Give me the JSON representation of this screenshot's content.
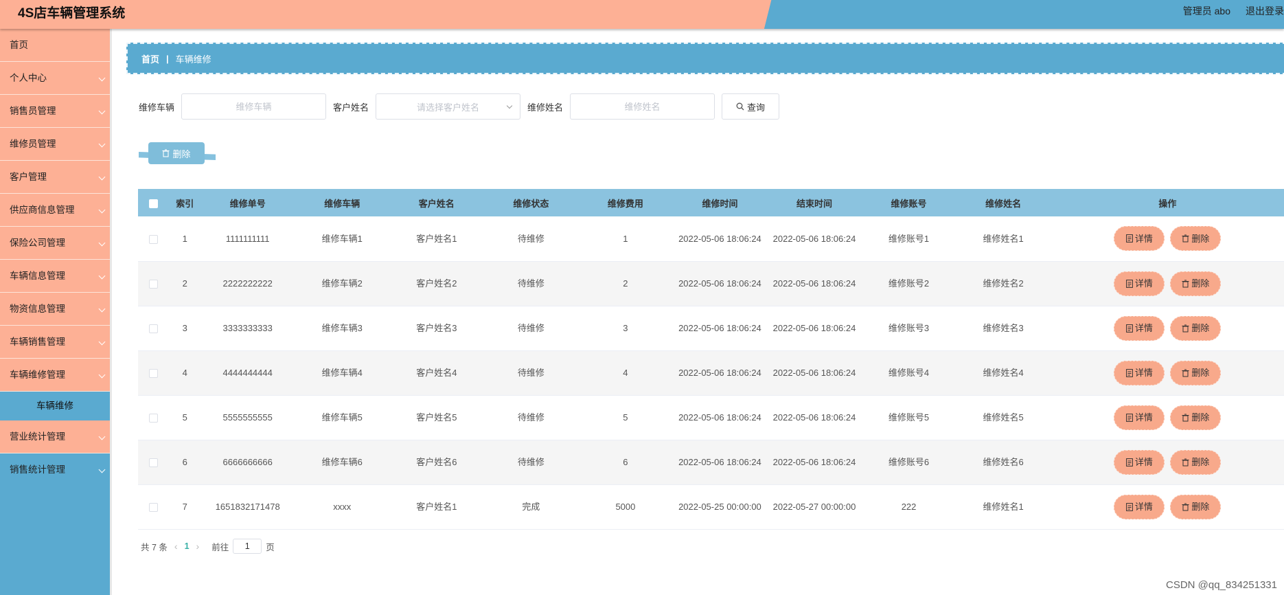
{
  "header": {
    "title": "4S店车辆管理系统",
    "user": "管理员 abo",
    "logout": "退出登录"
  },
  "sidebar": {
    "items": [
      {
        "label": "首页",
        "has_chevron": false
      },
      {
        "label": "个人中心",
        "has_chevron": true
      },
      {
        "label": "销售员管理",
        "has_chevron": true
      },
      {
        "label": "维修员管理",
        "has_chevron": true
      },
      {
        "label": "客户管理",
        "has_chevron": true
      },
      {
        "label": "供应商信息管理",
        "has_chevron": true
      },
      {
        "label": "保险公司管理",
        "has_chevron": true
      },
      {
        "label": "车辆信息管理",
        "has_chevron": true
      },
      {
        "label": "物资信息管理",
        "has_chevron": true
      },
      {
        "label": "车辆销售管理",
        "has_chevron": true
      },
      {
        "label": "车辆维修管理",
        "has_chevron": true,
        "expanded": true
      },
      {
        "label": "营业统计管理",
        "has_chevron": true
      },
      {
        "label": "销售统计管理",
        "has_chevron": true
      }
    ],
    "active_sub": "车辆维修"
  },
  "breadcrumb": {
    "home": "首页",
    "separator": "|",
    "current": "车辆维修"
  },
  "search": {
    "vehicle_label": "维修车辆",
    "vehicle_placeholder": "维修车辆",
    "customer_label": "客户姓名",
    "customer_placeholder": "请选择客户姓名",
    "repairer_label": "维修姓名",
    "repairer_placeholder": "维修姓名",
    "query_label": "查询"
  },
  "bulk_delete_label": "删除",
  "table": {
    "headers": [
      "索引",
      "维修单号",
      "维修车辆",
      "客户姓名",
      "维修状态",
      "维修费用",
      "维修时间",
      "结束时间",
      "维修账号",
      "维修姓名",
      "操作"
    ],
    "rows": [
      {
        "index": "1",
        "order_no": "1111111111",
        "vehicle": "维修车辆1",
        "customer": "客户姓名1",
        "status": "待维修",
        "fee": "1",
        "start_time": "2022-05-06 18:06:24",
        "end_time": "2022-05-06 18:06:24",
        "account": "维修账号1",
        "repairer": "维修姓名1"
      },
      {
        "index": "2",
        "order_no": "2222222222",
        "vehicle": "维修车辆2",
        "customer": "客户姓名2",
        "status": "待维修",
        "fee": "2",
        "start_time": "2022-05-06 18:06:24",
        "end_time": "2022-05-06 18:06:24",
        "account": "维修账号2",
        "repairer": "维修姓名2"
      },
      {
        "index": "3",
        "order_no": "3333333333",
        "vehicle": "维修车辆3",
        "customer": "客户姓名3",
        "status": "待维修",
        "fee": "3",
        "start_time": "2022-05-06 18:06:24",
        "end_time": "2022-05-06 18:06:24",
        "account": "维修账号3",
        "repairer": "维修姓名3"
      },
      {
        "index": "4",
        "order_no": "4444444444",
        "vehicle": "维修车辆4",
        "customer": "客户姓名4",
        "status": "待维修",
        "fee": "4",
        "start_time": "2022-05-06 18:06:24",
        "end_time": "2022-05-06 18:06:24",
        "account": "维修账号4",
        "repairer": "维修姓名4"
      },
      {
        "index": "5",
        "order_no": "5555555555",
        "vehicle": "维修车辆5",
        "customer": "客户姓名5",
        "status": "待维修",
        "fee": "5",
        "start_time": "2022-05-06 18:06:24",
        "end_time": "2022-05-06 18:06:24",
        "account": "维修账号5",
        "repairer": "维修姓名5"
      },
      {
        "index": "6",
        "order_no": "6666666666",
        "vehicle": "维修车辆6",
        "customer": "客户姓名6",
        "status": "待维修",
        "fee": "6",
        "start_time": "2022-05-06 18:06:24",
        "end_time": "2022-05-06 18:06:24",
        "account": "维修账号6",
        "repairer": "维修姓名6"
      },
      {
        "index": "7",
        "order_no": "1651832171478",
        "vehicle": "xxxx",
        "customer": "客户姓名1",
        "status": "完成",
        "fee": "5000",
        "start_time": "2022-05-25 00:00:00",
        "end_time": "2022-05-27 00:00:00",
        "account": "222",
        "repairer": "维修姓名1"
      }
    ],
    "detail_label": "详情",
    "delete_label": "删除"
  },
  "pagination": {
    "total": "共 7 条",
    "current_page": "1",
    "goto_label": "前往",
    "goto_value": "1",
    "page_suffix": "页"
  },
  "watermark": "CSDN @qq_834251331",
  "colors": {
    "salmon": "#fdb095",
    "blue": "#5aaad0",
    "table_header": "#8bc3df",
    "op_button": "#f8a98b",
    "page_active": "#39b0a6"
  }
}
